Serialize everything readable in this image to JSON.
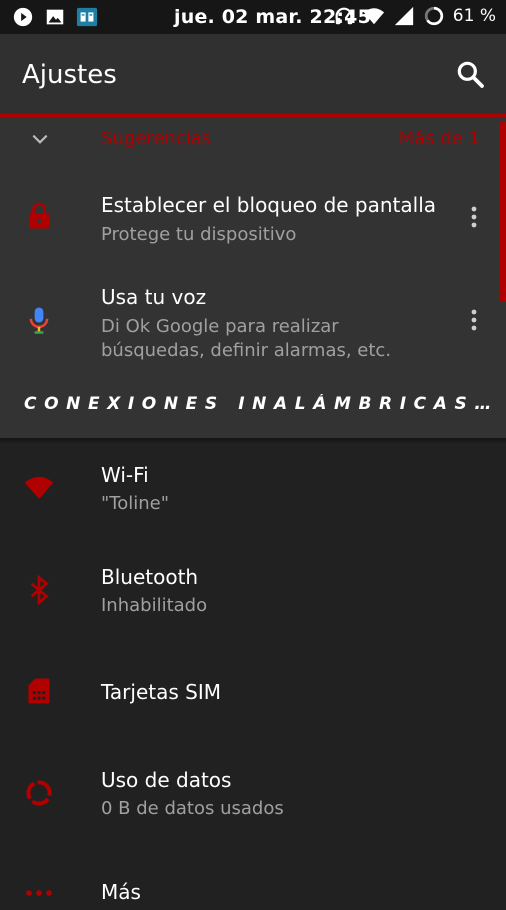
{
  "status_bar": {
    "time": "jue. 02 mar. 22:45",
    "battery_percent": "61 %",
    "left_icons": [
      "play-icon",
      "image-icon",
      "reader-app-icon"
    ],
    "right_icons": [
      "headphones-icon",
      "wifi-icon",
      "signal-icon",
      "battery-circle-icon"
    ]
  },
  "app_bar": {
    "title": "Ajustes"
  },
  "suggestions": {
    "title": "Sugerencias",
    "more": "Más de 1",
    "items": [
      {
        "title": "Establecer el bloqueo de pantalla",
        "subtitle": "Protege tu dispositivo",
        "icon": "lock-icon"
      },
      {
        "title": "Usa tu voz",
        "subtitle": "Di Ok Google para realizar búsquedas, definir alarmas, etc.",
        "icon": "microphone-icon"
      }
    ]
  },
  "section": {
    "header": "CONEXIONES INALÁMBRICAS Y REDES"
  },
  "settings": [
    {
      "title": "Wi-Fi",
      "subtitle": "\"Toline\"",
      "icon": "wifi-icon"
    },
    {
      "title": "Bluetooth",
      "subtitle": "Inhabilitado",
      "icon": "bluetooth-icon"
    },
    {
      "title": "Tarjetas SIM",
      "subtitle": "",
      "icon": "sim-card-icon"
    },
    {
      "title": "Uso de datos",
      "subtitle": "0 B de datos usados",
      "icon": "data-usage-icon"
    },
    {
      "title": "Más",
      "subtitle": "",
      "icon": "more-horizontal-icon"
    }
  ],
  "colors": {
    "accent": "#b00000",
    "background": "#212121",
    "panel": "#333333",
    "app_bar": "#303030"
  }
}
